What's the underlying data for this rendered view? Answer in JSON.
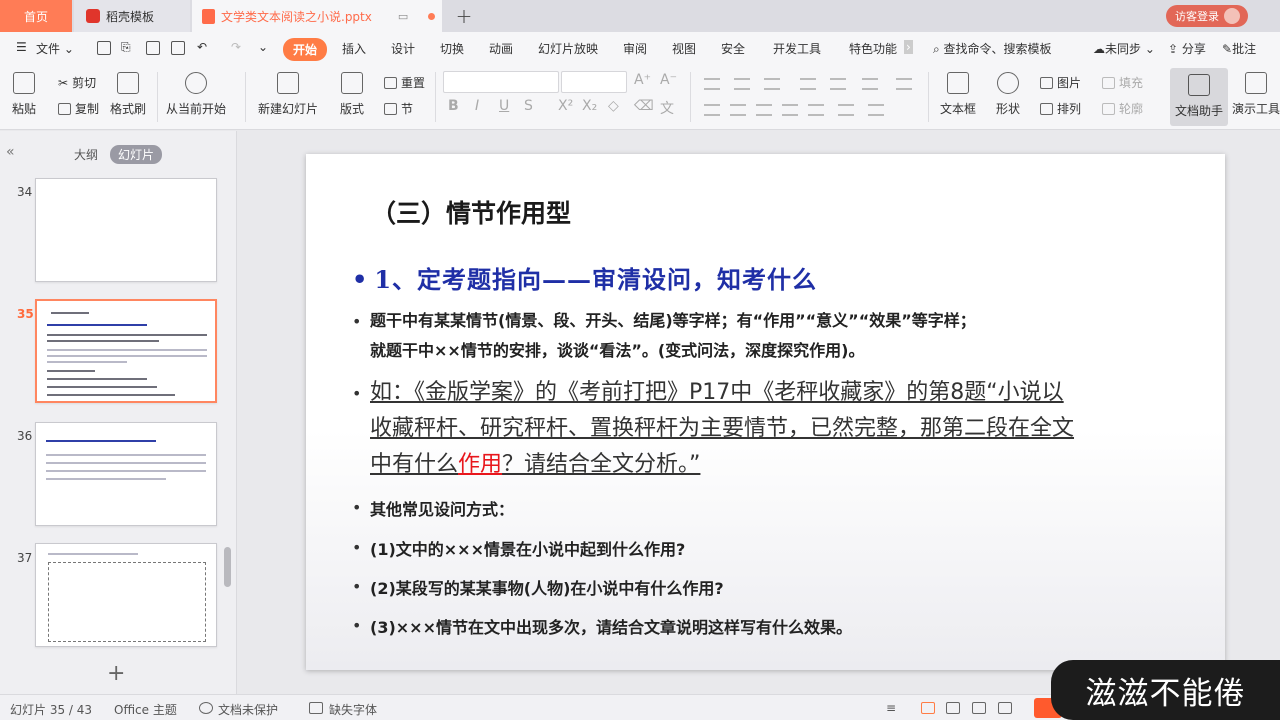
{
  "tabs": {
    "home": "首页",
    "template": "稻壳模板",
    "document": "文学类文本阅读之小说.pptx",
    "new_tab": "+",
    "visitor_login": "访客登录"
  },
  "menu": {
    "file": "文件",
    "items": [
      "开始",
      "插入",
      "设计",
      "切换",
      "动画",
      "幻灯片放映",
      "审阅",
      "视图",
      "安全",
      "开发工具",
      "特色功能"
    ],
    "search": "查找命令、搜索模板",
    "unsync": "未同步",
    "share": "分享",
    "comment": "批注"
  },
  "ribbon": {
    "paste": "粘贴",
    "cut": "剪切",
    "copy": "复制",
    "format_painter": "格式刷",
    "from_current": "从当前开始",
    "new_slide": "新建幻灯片",
    "layout": "版式",
    "reset": "重置",
    "section": "节",
    "font_size_up": "A⁺",
    "font_size_down": "A⁻",
    "bold": "B",
    "italic": "I",
    "underline": "U",
    "strike": "S",
    "superscript": "X²",
    "subscript": "X₂",
    "textbox": "文本框",
    "shape": "形状",
    "picture": "图片",
    "arrange": "排列",
    "fill": "填充",
    "outline": "轮廓",
    "doc_assistant": "文档助手",
    "presenter_tools": "演示工具"
  },
  "left_panel": {
    "outline_tab": "大纲",
    "slides_tab": "幻灯片",
    "slide_numbers": [
      "34",
      "35",
      "36",
      "37"
    ],
    "add": "+"
  },
  "slide": {
    "title": "（三）情节作用型",
    "heading": "1、定考题指向——审清设问，知考什么",
    "para1_line1": "题干中有某某情节(情景、段、开头、结尾)等字样；有“作用”“意义”“效果”等字样；",
    "para1_line2": "就题干中××情节的安排，谈谈“看法”。(变式问法，深度探究作用)。",
    "example_line1": "如：《金版学案》的《考前打把》P17中《老秤收藏家》的第8题“小说以",
    "example_line2": "收藏秤杆、研究秤杆、置换秤杆为主要情节，已然完整，那第二段在全文",
    "example_line3_a": "中有什么",
    "example_line3_red": "作用",
    "example_line3_b": "？请结合全文分析。”",
    "other_ways": "其他常见设问方式：",
    "q1": "(1)文中的×××情景在小说中起到什么作用?",
    "q2": "(2)某段写的某某事物(人物)在小说中有什么作用?",
    "q3": "(3)×××情节在文中出现多次，请结合文章说明这样写有什么效果。"
  },
  "status": {
    "slide_count": "幻灯片 35 / 43",
    "theme": "Office 主题",
    "unprotected": "文档未保护",
    "missing_font": "缺失字体"
  },
  "watermark": "滋滋不能倦",
  "colors": {
    "accent": "#ff7c45",
    "heading_blue": "#1f2fa6",
    "highlight_red": "#e8161c"
  }
}
